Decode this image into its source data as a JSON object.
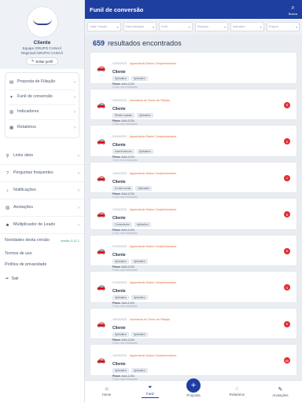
{
  "profile": {
    "name": "Cliente",
    "team": "Equipe GRUPO CANAÃ",
    "regional": "Regional GRUPO CANAÃ",
    "edit_label": "Editar perfil"
  },
  "menu_primary": [
    {
      "label": "Proposta de Filiação",
      "icon": "document-icon"
    },
    {
      "label": "Funil de conversão",
      "icon": "funnel-icon"
    },
    {
      "label": "Indicadores",
      "icon": "chart-icon"
    },
    {
      "label": "Relatórios",
      "icon": "report-icon"
    }
  ],
  "menu_secondary": [
    {
      "label": "Links úteis",
      "icon": "link-icon"
    },
    {
      "label": "Perguntas frequentes",
      "icon": "question-icon"
    },
    {
      "label": "Notificações",
      "icon": "bell-icon"
    },
    {
      "label": "Anotações",
      "icon": "note-icon"
    },
    {
      "label": "Multiplicador de Leads",
      "icon": "people-icon"
    }
  ],
  "version": {
    "label": "Novidades desta versão",
    "value": "versão 3.12.1"
  },
  "terms_label": "Termos de uso",
  "privacy_label": "Política de privacidade",
  "logout_label": "Sair",
  "header": {
    "title": "Funil de conversão",
    "search_label": "Busca"
  },
  "filters": [
    {
      "placeholder": "Data Criação"
    },
    {
      "placeholder": "Data Ativação"
    },
    {
      "placeholder": "Funil"
    },
    {
      "placeholder": "Situação"
    },
    {
      "placeholder": "Indicador"
    },
    {
      "placeholder": "Origem"
    }
  ],
  "results": {
    "count": "659",
    "label": "resultados encontrados"
  },
  "cards": [
    {
      "date": "03/04/2023",
      "status": "Aguardando Dados Complementares",
      "client": "Cliente",
      "tags": [
        "Aplicativo",
        "Aplicativo"
      ],
      "plate": "AAA-1234",
      "note": "O seu novo indicação",
      "badge": ""
    },
    {
      "date": "03/04/2023",
      "status": "Assinatura do Termo de Filiação",
      "client": "Cliente",
      "tags": [
        "Redes sociais",
        "Aplicativo"
      ],
      "plate": "AAA-1234",
      "note": "O seu novo indicação",
      "badge": "8"
    },
    {
      "date": "02/04/2023",
      "status": "Aguardando Dados Complementares",
      "client": "Cliente",
      "tags": [
        "Inserir/veículo",
        "Aplicativo"
      ],
      "plate": "AAA-1234",
      "note": "O seu novo indicação",
      "badge": "6"
    },
    {
      "date": "13/04/2023",
      "status": "Aguardando Dados Complementares",
      "client": "Cliente",
      "tags": [
        "À rede social",
        "Aplicativo"
      ],
      "plate": "AAA-1234",
      "note": "O seu novo indicação",
      "badge": "1"
    },
    {
      "date": "12/04/2023",
      "status": "Aguardando Dados Complementares",
      "client": "Cliente",
      "tags": [
        "Consultores",
        "Aplicativo"
      ],
      "plate": "AAA-1234",
      "note": "O seu novo indicação",
      "badge": "8"
    },
    {
      "date": "01/04/2023",
      "status": "Aguardando Dados Complementares",
      "client": "Cliente",
      "tags": [
        "Aplicativo",
        "Aplicativo"
      ],
      "plate": "AAA-1234",
      "note": "O seu novo indicação",
      "badge": "8"
    },
    {
      "date": "07/04/2023",
      "status": "Aguardando Dados Complementares",
      "client": "Cliente",
      "tags": [
        "Aplicativo",
        "Aplicativo"
      ],
      "plate": "AAA-1234",
      "note": "O seu novo indicação",
      "badge": "6"
    },
    {
      "date": "16/03/2023",
      "status": "Assinatura do Termo de Filiação",
      "client": "Cliente",
      "tags": [
        "Aplicativo",
        "Aplicativo"
      ],
      "plate": "AAA-1234",
      "note": "O seu novo indicação",
      "badge": "6"
    },
    {
      "date": "13/03/2023",
      "status": "Aguardando Dados Complementares",
      "client": "Cliente",
      "tags": [
        "Aplicativo",
        "Aplicativo"
      ],
      "plate": "AAA-1234",
      "note": "O seu novo indicação",
      "badge": "56"
    }
  ],
  "bottom_nav": [
    {
      "label": "Home",
      "icon": "home-icon"
    },
    {
      "label": "Funil",
      "icon": "funnel-icon"
    },
    {
      "label": "Proposta",
      "icon": "plus-icon"
    },
    {
      "label": "Relatórios",
      "icon": "report-icon"
    },
    {
      "label": "Anotações",
      "icon": "note-icon"
    }
  ],
  "colors": {
    "primary": "#1f3fa0",
    "status": "#e26a3c",
    "badge": "#e03131"
  }
}
